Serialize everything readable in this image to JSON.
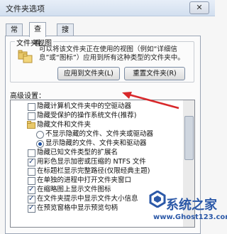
{
  "window": {
    "title": "文件夹选项",
    "close_glyph": "✕"
  },
  "tabs": [
    {
      "label": "常规",
      "active": false
    },
    {
      "label": "查看",
      "active": true
    },
    {
      "label": "搜索",
      "active": false
    }
  ],
  "folder_views": {
    "group_title": "文件夹视图",
    "description": "可以将该文件夹正在使用的视图（例如“详细信息”或“图标”）应用到所有这种类型的文件夹中。",
    "apply_button": "应用到文件夹(L)",
    "reset_button": "重置文件夹(R)"
  },
  "advanced": {
    "label": "高级设置：",
    "items": [
      {
        "type": "checkbox",
        "checked": false,
        "indent": 0,
        "label": "隐藏计算机文件夹中的空驱动器"
      },
      {
        "type": "checkbox",
        "checked": false,
        "indent": 0,
        "label": "隐藏受保护的操作系统文件(推荐)"
      },
      {
        "type": "folder",
        "checked": false,
        "indent": 0,
        "label": "隐藏文件和文件夹"
      },
      {
        "type": "radio",
        "checked": false,
        "indent": 1,
        "label": "不显示隐藏的文件、文件夹或驱动器"
      },
      {
        "type": "radio",
        "checked": true,
        "indent": 1,
        "label": "显示隐藏的文件、文件夹和驱动器"
      },
      {
        "type": "checkbox",
        "checked": false,
        "indent": 0,
        "label": "隐藏已知文件类型的扩展名"
      },
      {
        "type": "checkbox",
        "checked": true,
        "indent": 0,
        "label": "用彩色显示加密或压缩的 NTFS 文件"
      },
      {
        "type": "checkbox",
        "checked": false,
        "indent": 0,
        "label": "在标题栏显示完整路径(仅限经典主题)"
      },
      {
        "type": "checkbox",
        "checked": false,
        "indent": 0,
        "label": "在单独的进程中打开文件夹窗口"
      },
      {
        "type": "checkbox",
        "checked": true,
        "indent": 0,
        "label": "在缩略图上显示文件图标"
      },
      {
        "type": "checkbox",
        "checked": true,
        "indent": 0,
        "label": "在文件夹提示中显示文件大小信息"
      },
      {
        "type": "checkbox",
        "checked": true,
        "indent": 0,
        "label": "在预览窗格中显示预览句柄"
      }
    ]
  },
  "watermark": {
    "title": "系统之家",
    "url": "www.Ghost123.com"
  },
  "colors": {
    "arrow": "#d8282a",
    "brand": "#2c59a8"
  }
}
